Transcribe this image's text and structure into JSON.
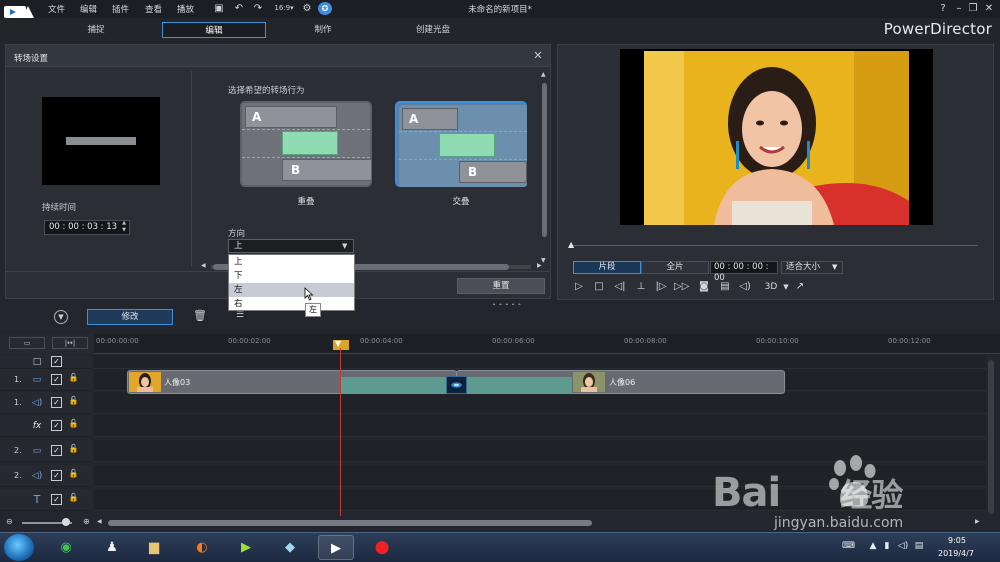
{
  "menu": {
    "file": "文件",
    "edit": "编辑",
    "plugins": "插件",
    "view": "查看",
    "play": "播放"
  },
  "window": {
    "title": "未命名的新项目*"
  },
  "modes": {
    "capture": "捕捉",
    "edit": "编辑",
    "produce": "制作",
    "disc": "创建光盘"
  },
  "brand": "PowerDirector",
  "panel": {
    "title": "转场设置",
    "duration_label": "持续时间",
    "duration_value": "00 : 00 : 03 : 13",
    "behavior_label": "选择希望的转场行为",
    "overlap_label": "重叠",
    "cross_label": "交叠",
    "block_a": "A",
    "block_b": "B",
    "direction_label": "方向",
    "direction_value": "上",
    "direction_options": [
      "上",
      "下",
      "左",
      "右"
    ],
    "tooltip": "左",
    "reset_label": "重置"
  },
  "player": {
    "clip_label": "片段",
    "movie_label": "全片",
    "timecode": "00 : 00 : 00 : 00",
    "fit_label": "适合大小",
    "three_d": "3D"
  },
  "timeline": {
    "modify_label": "修改",
    "ruler": [
      "00:00:00:00",
      "00:00:02:00",
      "00:00:04:00",
      "00:00:06:00",
      "00:00:08:00",
      "00:00:10:00",
      "00:00:12:00"
    ],
    "tracks": [
      {
        "num": "",
        "icon": "video-icon"
      },
      {
        "num": "1.",
        "icon": "video-icon"
      },
      {
        "num": "1.",
        "icon": "audio-icon"
      },
      {
        "num": "",
        "icon": "fx-icon",
        "label": "fx"
      },
      {
        "num": "2.",
        "icon": "video-icon"
      },
      {
        "num": "2.",
        "icon": "audio-icon"
      },
      {
        "num": "",
        "icon": "title-icon",
        "label": "T"
      }
    ],
    "clip1_label": "人像03",
    "clip2_label": "人像06"
  },
  "taskbar": {
    "time": "9:05",
    "date": "2019/4/7"
  },
  "watermark": {
    "text": "Bai",
    "text2": "经验",
    "url": "jingyan.baidu.com"
  }
}
